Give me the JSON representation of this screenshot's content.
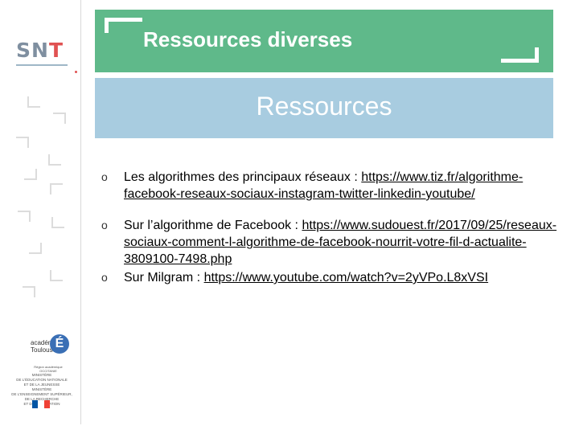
{
  "sidebar": {
    "logo_text_main": "SN",
    "logo_text_accent": "T",
    "academy": {
      "name_line1": "académie",
      "name_line2": "Toulouse",
      "e_letter": "É",
      "subtitle": "Région académique OCCITANIE",
      "ministry_lines": [
        "MINISTÈRE",
        "DE L'ÉDUCATION NATIONALE",
        "ET DE LA JEUNESSE",
        "MINISTÈRE",
        "DE L'ENSEIGNEMENT SUPÉRIEUR,",
        "DE LA RECHERCHE",
        "ET DE L'INNOVATION"
      ],
      "flag_colors": [
        "#0055a4",
        "#ffffff",
        "#ef4135"
      ]
    }
  },
  "header": {
    "title": "Ressources diverses",
    "color": "#5fb98a"
  },
  "band": {
    "title": "Ressources",
    "color": "#a8cce0"
  },
  "items": [
    {
      "bullet": "o",
      "prefix": "Les algorithmes des principaux réseaux : ",
      "link": "https://www.tiz.fr/algorithme-facebook-reseaux-sociaux-instagram-twitter-linkedin-youtube/"
    },
    {
      "bullet": "o",
      "prefix": "Sur l’algorithme de Facebook : ",
      "link": "https://www.sudouest.fr/2017/09/25/reseaux-sociaux-comment-l-algorithme-de-facebook-nourrit-votre-fil-d-actualite-3809100-7498.php"
    },
    {
      "bullet": "o",
      "prefix": "Sur Milgram : ",
      "link": "https://www.youtube.com/watch?v=2yVPo.L8xVSI"
    }
  ]
}
